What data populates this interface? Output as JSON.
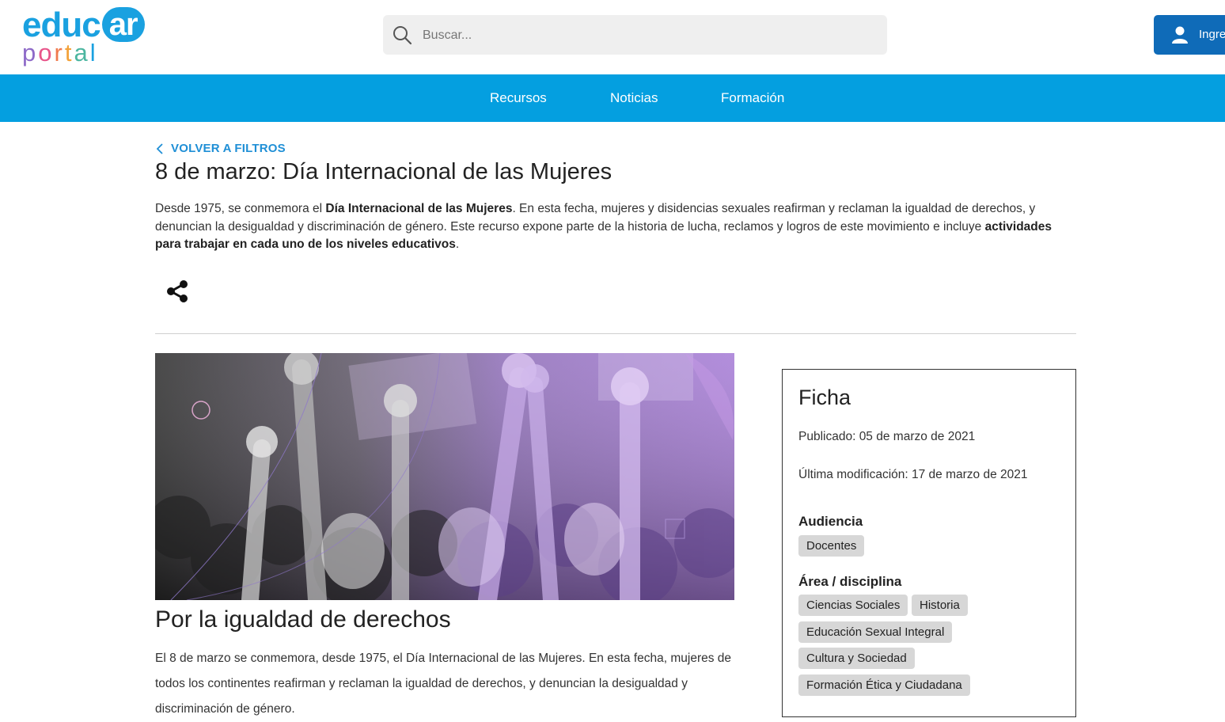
{
  "logo": {
    "main": "educ",
    "badge": "ar",
    "sub": [
      "p",
      "o",
      "r",
      "t",
      "a",
      "l"
    ],
    "sub_colors": [
      "#8e6ac8",
      "#e8558a",
      "#f07a4e",
      "#f3a23a",
      "#4cb6a0",
      "#1aa1e0"
    ]
  },
  "search": {
    "placeholder": "Buscar..."
  },
  "login": {
    "label": "Ingresar"
  },
  "nav": {
    "items": [
      "Recursos",
      "Noticias",
      "Formación"
    ]
  },
  "page": {
    "back": "VOLVER A FILTROS",
    "title": "8 de marzo: Día Internacional de las Mujeres",
    "intro": {
      "p1": "Desde 1975, se conmemora el ",
      "b1": "Día Internacional de las Mujeres",
      "p2": ". En esta fecha, mujeres y disidencias sexuales reafirman y reclaman la igualdad de derechos, y denuncian la desigualdad y discriminación de género. Este recurso expone parte de la historia de lucha, reclamos y logros de este movimiento e incluye ",
      "b2": "actividades para trabajar en cada uno de los niveles educativos",
      "p3": "."
    },
    "section_title": "Por la igualdad de derechos",
    "section_body": "El 8 de marzo se conmemora, desde 1975, el Día Internacional de las Mujeres. En esta fecha, mujeres de todos los continentes reafirman y reclaman la igualdad de derechos, y denuncian la desigualdad y discriminación de género."
  },
  "ficha": {
    "title": "Ficha",
    "published": "Publicado: 05 de marzo de 2021",
    "modified": "Última modificación: 17 de marzo de 2021",
    "audiencia_label": "Audiencia",
    "audiencia": [
      "Docentes"
    ],
    "area_label": "Área / disciplina",
    "areas": [
      "Ciencias Sociales",
      "Historia",
      "Educación Sexual Integral",
      "Cultura y Sociedad",
      "Formación Ética y Ciudadana"
    ]
  },
  "colors": {
    "nav": "#049fe0",
    "login": "#0f6bb8",
    "link": "#1f8fd6",
    "hero_tint": "#9b6bd0"
  }
}
